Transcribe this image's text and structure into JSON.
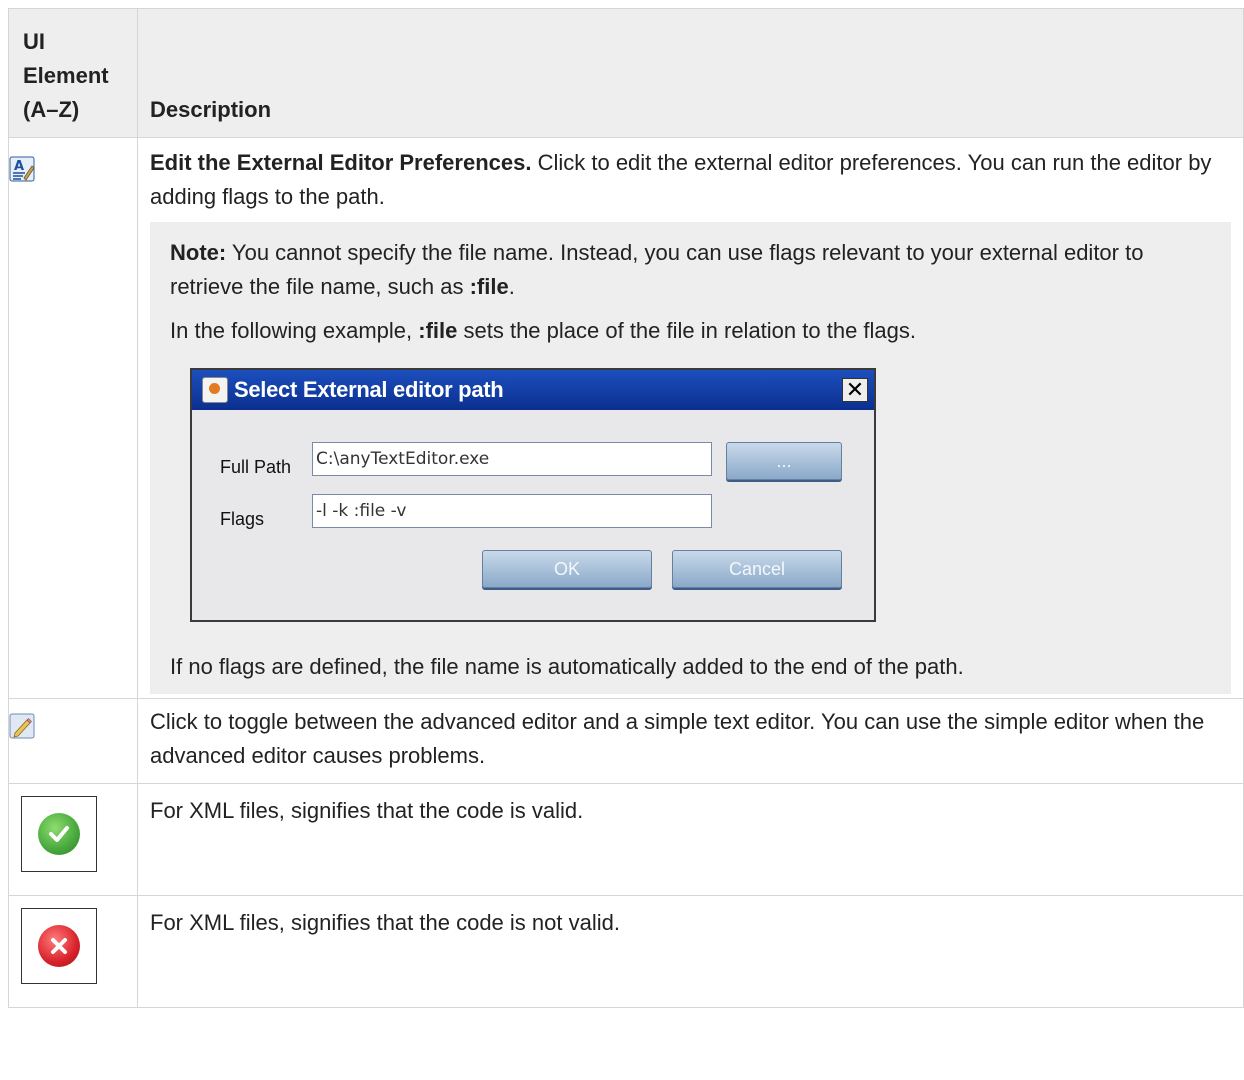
{
  "table": {
    "header": {
      "col1": "UI Element (A–Z)",
      "col2": "Description"
    },
    "rows": [
      {
        "icon": "edit-text-icon",
        "title": "Edit the External Editor Preferences.",
        "text": " Click to edit the external editor preferences. You can run the editor by adding flags to the path.",
        "note": {
          "label": "Note:",
          "text1": " You cannot specify the file name. Instead, you can use flags relevant to your external editor to retrieve the file name, such as ",
          "code1": ":file",
          "text1_end": ".",
          "text2_start": "In the following example, ",
          "code2": ":file",
          "text2_end": " sets the place of the file in relation to the flags.",
          "text3": "If no flags are defined, the file name is automatically added to the end of the path."
        },
        "dialog": {
          "title": "Select External editor path",
          "close": "✕",
          "full_path_label": "Full Path",
          "full_path_value": "C:\\anyTextEditor.exe",
          "browse_label": "...",
          "flags_label": "Flags",
          "flags_value": "-l -k :file -v",
          "ok_label": "OK",
          "cancel_label": "Cancel"
        }
      },
      {
        "icon": "pencil-icon",
        "text": "Click to toggle between the advanced editor and a simple text editor. You can use the simple editor when the advanced editor causes problems."
      },
      {
        "icon": "valid-check-icon",
        "text": "For XML files, signifies that the code is valid.",
        "color": "#46a83c"
      },
      {
        "icon": "invalid-x-icon",
        "text": "For XML files, signifies that the code is not valid.",
        "color": "#d8222a"
      }
    ]
  }
}
